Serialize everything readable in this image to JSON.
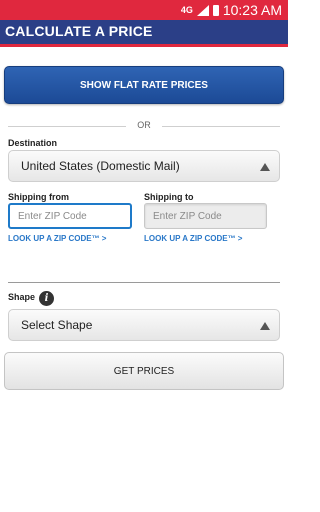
{
  "status_bar": {
    "network": "4G",
    "time": "10:23 AM"
  },
  "header": {
    "title": "CALCULATE A PRICE"
  },
  "flat_rate_button": {
    "label": "SHOW FLAT RATE PRICES"
  },
  "divider": {
    "text": "OR"
  },
  "destination": {
    "label": "Destination",
    "selected": "United States (Domestic Mail)"
  },
  "shipping_from": {
    "label": "Shipping from",
    "placeholder": "Enter ZIP Code",
    "lookup_link": "LOOK UP A ZIP CODE™ >"
  },
  "shipping_to": {
    "label": "Shipping to",
    "placeholder": "Enter ZIP Code",
    "lookup_link": "LOOK UP A ZIP CODE™ >"
  },
  "shape": {
    "label": "Shape",
    "info_icon_glyph": "i",
    "selected": "Select Shape"
  },
  "get_prices_button": {
    "label": "GET PRICES"
  },
  "colors": {
    "status_bar": "#e0283e",
    "header": "#2b3f87",
    "accent_link": "#2a78c8",
    "primary_button": "#1c4a96"
  }
}
